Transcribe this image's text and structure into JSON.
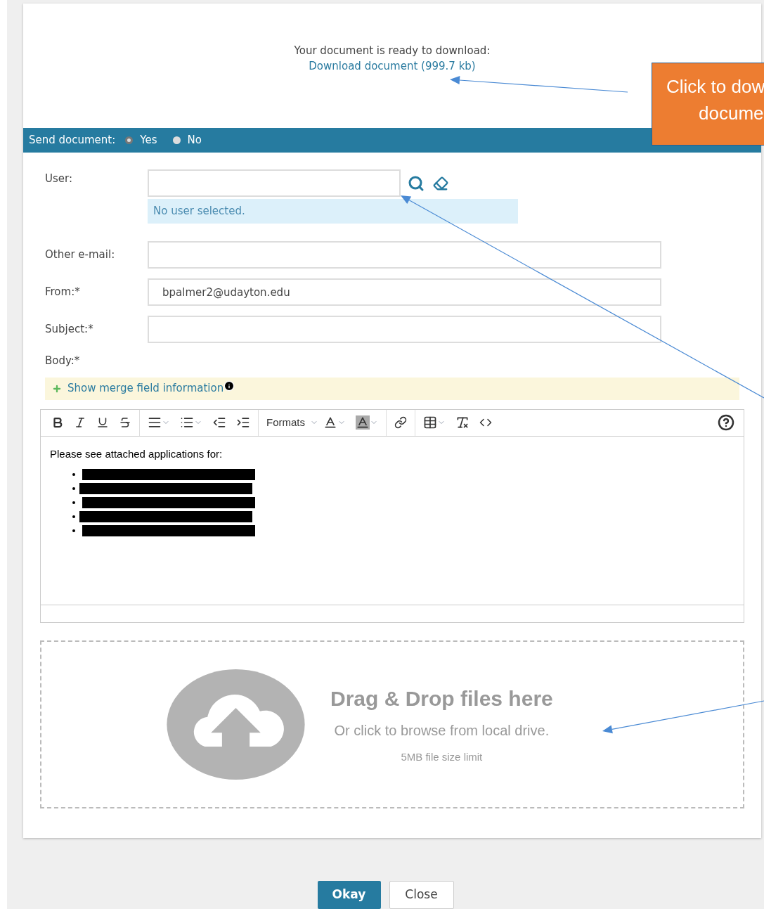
{
  "download": {
    "prompt": "Your document is ready to download:",
    "link": "Download document (999.7 kb)"
  },
  "callout": {
    "lines": [
      "Click to dow",
      "docume"
    ]
  },
  "send_bar": {
    "label": "Send document:",
    "options": [
      {
        "label": "Yes",
        "selected": true
      },
      {
        "label": "No",
        "selected": false
      }
    ]
  },
  "form": {
    "user": {
      "label": "User:",
      "status": "No user selected."
    },
    "fields": [
      {
        "label": "Other e-mail:"
      },
      {
        "label": "From:*",
        "value": "bpalmer2@udayton.edu"
      },
      {
        "label": "Subject:*"
      }
    ],
    "body_label": "Body:*"
  },
  "merge": {
    "label": "Show merge field information"
  },
  "editor": {
    "formats": "Formats",
    "intro": "Please see attached applications for:",
    "bullets": [
      {
        "kind": "redacted"
      },
      {
        "kind": "redacted"
      },
      {
        "kind": "redacted"
      },
      {
        "kind": "redacted"
      },
      {
        "kind": "redacted"
      }
    ]
  },
  "dropzone": {
    "title": "Drag & Drop files here",
    "subtitle": "Or click to browse from local drive.",
    "limit": "5MB file size limit"
  },
  "buttons": [
    {
      "label": "Okay",
      "kind": "primary"
    },
    {
      "label": "Close",
      "kind": "secondary"
    }
  ]
}
